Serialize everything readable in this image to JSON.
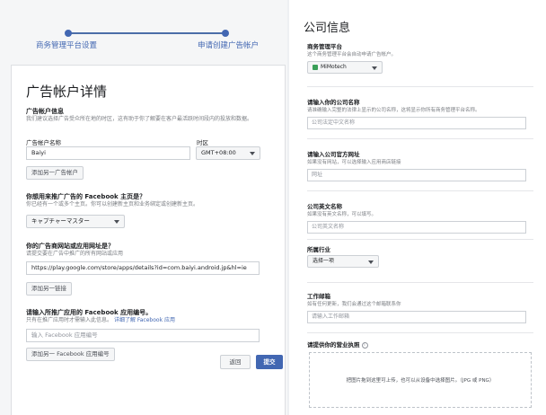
{
  "stepper": {
    "step1": "商务管理平台设置",
    "step2": "申请创建广告帐户"
  },
  "left": {
    "title": "广告帐户详情",
    "account_info": {
      "title": "广告帐户信息",
      "desc": "我们建议选择广告受众所在地的时区，这有助于你了解要在客户最活跃时间段内的投放和数据。",
      "name_label": "广告帐户名称",
      "name_value": "Baiyi",
      "timezone_label": "时区",
      "timezone_value": "GMT+08:00",
      "add_button": "添加另一广告帐户"
    },
    "page_section": {
      "title": "你想用来推广广告的 Facebook 主页是？",
      "desc": "你已经有一个或多个主页。你可以创建新主页和业务绑定或创建新主页。",
      "page_value": "キャプチャーマスター"
    },
    "app_section": {
      "title": "你的广告商网站或应用网址是？",
      "desc": "请提交要在广告中推广的所有网站或应用",
      "url_value": "https://play.google.com/store/apps/details?id=com.baiyi.android.jp&hl=ie",
      "add_button": "添加另一链接"
    },
    "fb_app_section": {
      "title": "请输入所推广应用的 Facebook 应用编号。",
      "desc": "只有在推广应用时才需输入此信息。",
      "desc_link": "详细了解 Facebook 应用",
      "input_placeholder": "输入 Facebook 应用编号",
      "add_button": "添加另一 Facebook 应用编号"
    },
    "back_button": "返回",
    "submit_button": "提交"
  },
  "right": {
    "title": "公司信息",
    "biz_platform": {
      "label": "商务管理平台",
      "desc": "这个商务管理平台会自动申请广告帐户。",
      "value": "MiMotech"
    },
    "company_name": {
      "label": "请输入你的公司名称",
      "desc": "请准确输入完整的法律上显示的公司名称，这将显示你所有商务管理平台名称。",
      "placeholder": "公司法定中文名称"
    },
    "website": {
      "label": "请输入公司官方网址",
      "desc": "如果没有网站，可以选择输入应用商店链接",
      "placeholder": "网址"
    },
    "english_name": {
      "label": "公司英文名称",
      "desc": "如果没有英文名称，可以填写。",
      "placeholder": "公司英文名称"
    },
    "industry": {
      "label": "所属行业",
      "value": "选择一项"
    },
    "email": {
      "label": "工作邮箱",
      "desc": "如有任何更新，我们会通过这个邮箱联系你",
      "placeholder": "请输入工作邮箱"
    },
    "license": {
      "label": "请提供你的营业执照",
      "upload_text": "把图片拖到这里可上传，也可以从设备中选择图片。（JPG 或 PNG）"
    }
  },
  "colors": {
    "primary": "#4267b2",
    "logo_green": "#3a9f58"
  },
  "icons": {
    "info": "info-icon",
    "caret": "caret-down-icon",
    "logo": "company-logo-icon"
  }
}
